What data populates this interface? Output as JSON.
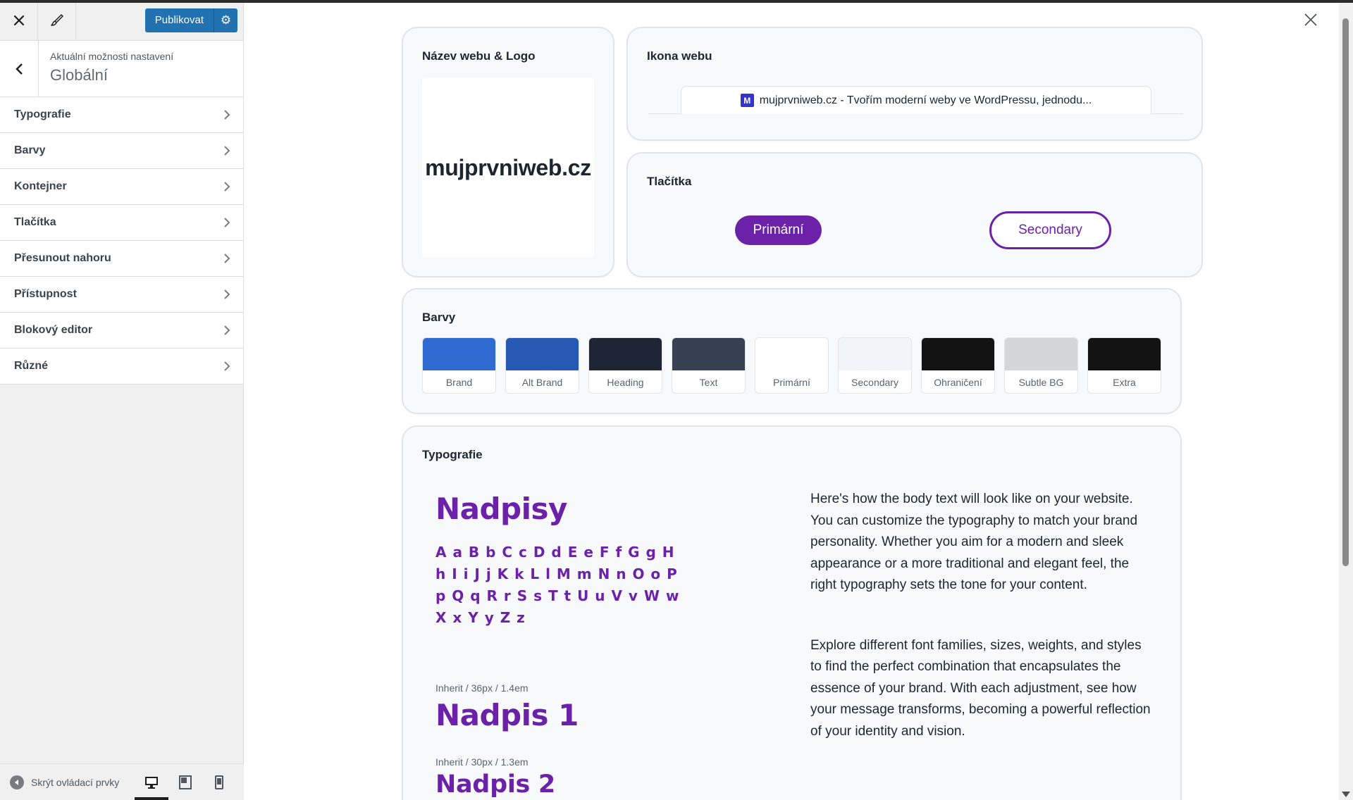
{
  "sidebar": {
    "publish_label": "Publikovat",
    "subtitle": "Aktuální možnosti nastavení",
    "title": "Globální",
    "items": [
      {
        "label": "Typografie"
      },
      {
        "label": "Barvy"
      },
      {
        "label": "Kontejner"
      },
      {
        "label": "Tlačítka"
      },
      {
        "label": "Přesunout nahoru"
      },
      {
        "label": "Přístupnost"
      },
      {
        "label": "Blokový editor"
      },
      {
        "label": "Různé"
      }
    ],
    "hide_controls_label": "Skrýt ovládací prvky",
    "devices": [
      "desktop-icon",
      "tablet-icon",
      "mobile-icon"
    ],
    "active_device": "desktop"
  },
  "preview": {
    "logo_card": {
      "title": "Název webu & Logo",
      "logo_text": "mujprvniweb.cz"
    },
    "icon_card": {
      "title": "Ikona webu",
      "favicon_letter": "M",
      "tab_text": "mujprvniweb.cz - Tvořím moderní weby ve WordPressu, jednodu..."
    },
    "buttons_card": {
      "title": "Tlačítka",
      "primary_label": "Primární",
      "secondary_label": "Secondary"
    },
    "colors_card": {
      "title": "Barvy",
      "swatches": [
        {
          "label": "Brand",
          "color": "#2f6bd0"
        },
        {
          "label": "Alt Brand",
          "color": "#2559b3"
        },
        {
          "label": "Heading",
          "color": "#1e2636"
        },
        {
          "label": "Text",
          "color": "#374152"
        },
        {
          "label": "Primární",
          "color": "#ffffff"
        },
        {
          "label": "Secondary",
          "color": "#f1f4f8"
        },
        {
          "label": "Ohraničení",
          "color": "#131313"
        },
        {
          "label": "Subtle BG",
          "color": "#d4d6da"
        },
        {
          "label": "Extra",
          "color": "#131313"
        }
      ]
    },
    "typography_card": {
      "title": "Typografie",
      "headings_sample": "Nadpisy",
      "alphabet": "A a B b C c D d E e F f G g H h I i J j K k L l M m N n O o P p Q q R r S s T t U u V v W w X x Y y Z z",
      "h1_meta": "Inherit / 36px / 1.4em",
      "h1_sample": "Nadpis 1",
      "h2_meta": "Inherit / 30px / 1.3em",
      "h2_sample": "Nadpis 2",
      "body_paragraph_1": "Here's how the body text will look like on your website. You can customize the typography to match your brand personality. Whether you aim for a modern and sleek appearance or a more traditional and elegant feel, the right typography sets the tone for your content.",
      "body_paragraph_2": "Explore different font families, sizes, weights, and styles to find the perfect combination that encapsulates the essence of your brand. With each adjustment, see how your message transforms, becoming a powerful reflection of your identity and vision."
    },
    "accent_color": "#6b21a8"
  }
}
